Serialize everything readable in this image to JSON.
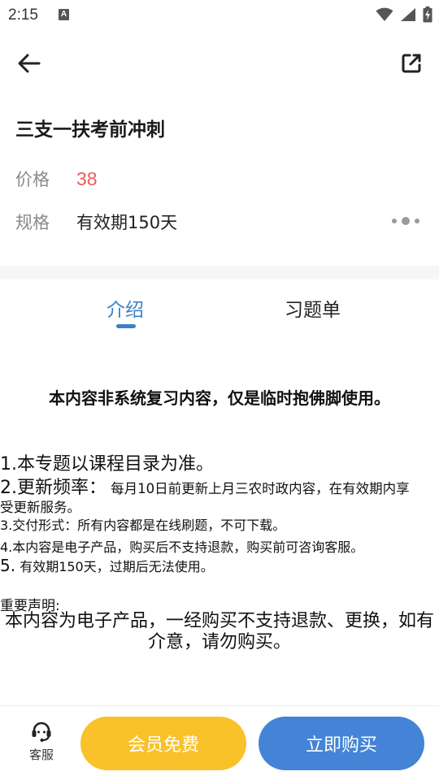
{
  "status_bar": {
    "time": "2:15",
    "notification_letter": "A"
  },
  "header": {
    "back_icon": "arrow-left-icon",
    "share_icon": "open-external-icon"
  },
  "product": {
    "title": "三支一扶考前冲刺",
    "price_label": "价格",
    "price_value": "38",
    "spec_label": "规格",
    "spec_value": "有效期150天",
    "price_color": "#f05a5a"
  },
  "tabs": [
    {
      "label": "介绍",
      "active": true
    },
    {
      "label": "习题单",
      "active": false
    }
  ],
  "accent_color": "#3f7fc8",
  "content": {
    "heading": "本内容非系统复习内容，仅是临时抱佛脚使用。",
    "item1": "1.本专题以课程目录为准。",
    "item2_prefix": "2.更新频率：",
    "item2_text": "每月10日前更新上月三农时政内容，在有效期内享",
    "item2_cont": "受更新服务。",
    "item3": "3.交付形式：所有内容都是在线刷题，不可下载。",
    "item4": "4.本内容是电子产品，购买后不支持退款，购买前可咨询客服。",
    "item5_prefix": "5.",
    "item5_text": "有效期150天，过期后无法使用。",
    "notice_title": "重要声明:",
    "notice_text": "本内容为电子产品，一经购买不支持退款、更换，如有介意，请勿购买。"
  },
  "bottom_bar": {
    "service_label": "客服",
    "service_icon": "headset-icon",
    "member_button": "会员免费",
    "buy_button": "立即购买",
    "member_color": "#f9c12a",
    "buy_color": "#4384d6"
  }
}
